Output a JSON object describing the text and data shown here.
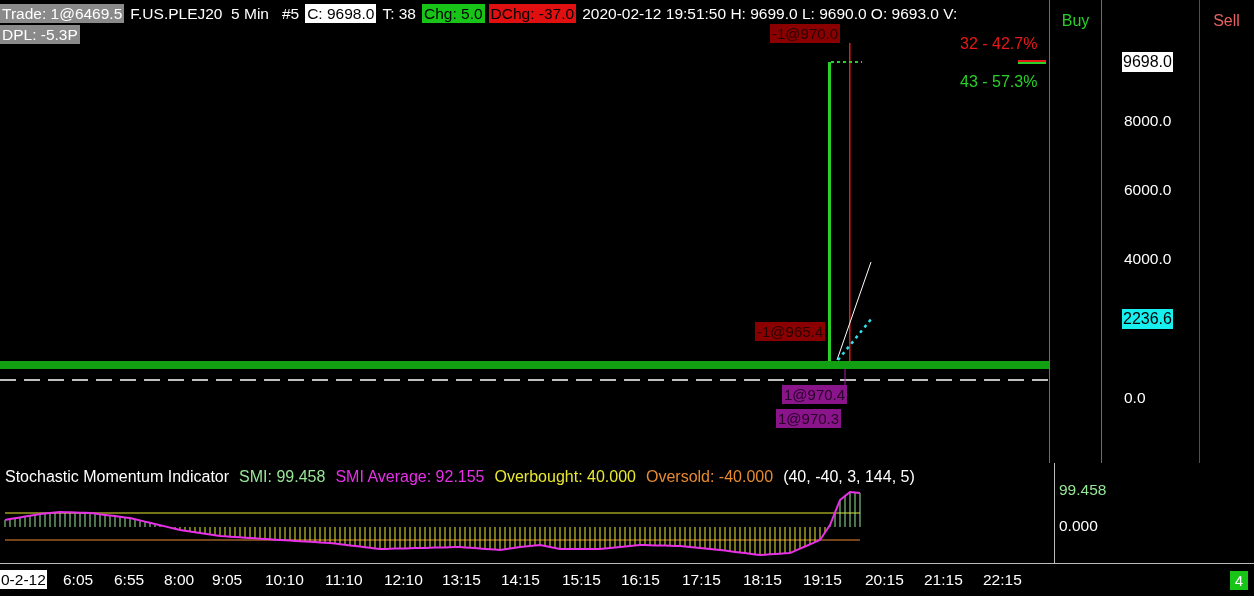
{
  "header": {
    "fields": [
      {
        "text": "Trade: 1@6469.5",
        "kind": "grey"
      },
      {
        "text": "F.US.PLEJ20  5 Min   #5",
        "kind": "plain"
      },
      {
        "text": "C: 9698.0",
        "kind": "white"
      },
      {
        "text": "T: 38",
        "kind": "plain"
      },
      {
        "text": "Chg: 5.0",
        "kind": "green"
      },
      {
        "text": "DChg: -37.0",
        "kind": "red"
      },
      {
        "text": "2020-02-12 19:51:50 H: 9699.0 L: 9690.0 O: 9693.0 V:",
        "kind": "plain"
      }
    ],
    "dpl": "DPL: -5.3P"
  },
  "order_labels": [
    {
      "text": "-1@970.0",
      "kind": "sell"
    },
    {
      "text": "-1@965.4",
      "kind": "sell"
    },
    {
      "text": "1@970.4",
      "kind": "buy"
    },
    {
      "text": "1@970.3",
      "kind": "buy"
    }
  ],
  "stats": [
    {
      "text": "32 - 42.7%",
      "kind": "sell"
    },
    {
      "text": "43 - 57.3%",
      "kind": "buy"
    }
  ],
  "buy_label": "Buy",
  "sell_label": "Sell",
  "price_axis": {
    "ticks": [
      "8000.0",
      "6000.0",
      "4000.0",
      "0.0"
    ],
    "markers": [
      {
        "text": "9698.0",
        "kind": "last"
      },
      {
        "text": "2236.6",
        "kind": "cyan"
      }
    ]
  },
  "indicator": {
    "title": "Stochastic Momentum Indicator",
    "legend": [
      {
        "text": "SMI: 99.458",
        "color": "#98e698"
      },
      {
        "text": "SMI Average: 92.155",
        "color": "#e830e8"
      },
      {
        "text": "Overbought: 40.000",
        "color": "#e8e830"
      },
      {
        "text": "Oversold: -40.000",
        "color": "#e88a30"
      }
    ],
    "params": "(40, -40, 3, 144, 5)",
    "axis": [
      {
        "text": "99.458",
        "kind": "smi"
      },
      {
        "text": "0.000",
        "kind": "plain"
      }
    ]
  },
  "time_axis": [
    {
      "text": "0-2-12",
      "kind": "date"
    },
    {
      "text": "6:05",
      "kind": "time"
    },
    {
      "text": "6:55",
      "kind": "time"
    },
    {
      "text": "8:00",
      "kind": "time"
    },
    {
      "text": "9:05",
      "kind": "time"
    },
    {
      "text": "10:10",
      "kind": "time"
    },
    {
      "text": "11:10",
      "kind": "time"
    },
    {
      "text": "12:10",
      "kind": "time"
    },
    {
      "text": "13:15",
      "kind": "time"
    },
    {
      "text": "14:15",
      "kind": "time"
    },
    {
      "text": "15:15",
      "kind": "time"
    },
    {
      "text": "16:15",
      "kind": "time"
    },
    {
      "text": "17:15",
      "kind": "time"
    },
    {
      "text": "18:15",
      "kind": "time"
    },
    {
      "text": "19:15",
      "kind": "time"
    },
    {
      "text": "20:15",
      "kind": "time"
    },
    {
      "text": "21:15",
      "kind": "time"
    },
    {
      "text": "22:15",
      "kind": "time"
    }
  ],
  "page_badge": "4"
}
